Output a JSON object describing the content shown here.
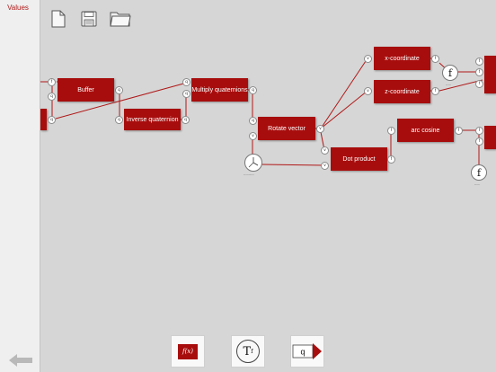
{
  "sidebar": {
    "title": "Values"
  },
  "toolbar": {
    "icons": [
      "new-document-icon",
      "save-icon",
      "open-folder-icon"
    ]
  },
  "nodes": {
    "buffer": "Buffer",
    "multiply_quaternions": "Multiply quaternions",
    "inverse_quaternion": "Inverse quaternion",
    "rotate_vector": "Rotate vector",
    "dot_product": "Dot product",
    "x_coordinate": "x-coordinate",
    "z_coordinate": "z-coordinate",
    "arc_cosine": "arc cosine"
  },
  "ports": {
    "f": "f",
    "q": "q",
    "v": "v"
  },
  "functions": {
    "f": "f"
  },
  "dock": {
    "fx_label": "f(x)",
    "tf_label": "T",
    "tf_sup": "f",
    "q_label": "q"
  },
  "colors": {
    "node": "#a80d0d",
    "wire": "#b01818",
    "canvas": "#d6d6d6"
  }
}
